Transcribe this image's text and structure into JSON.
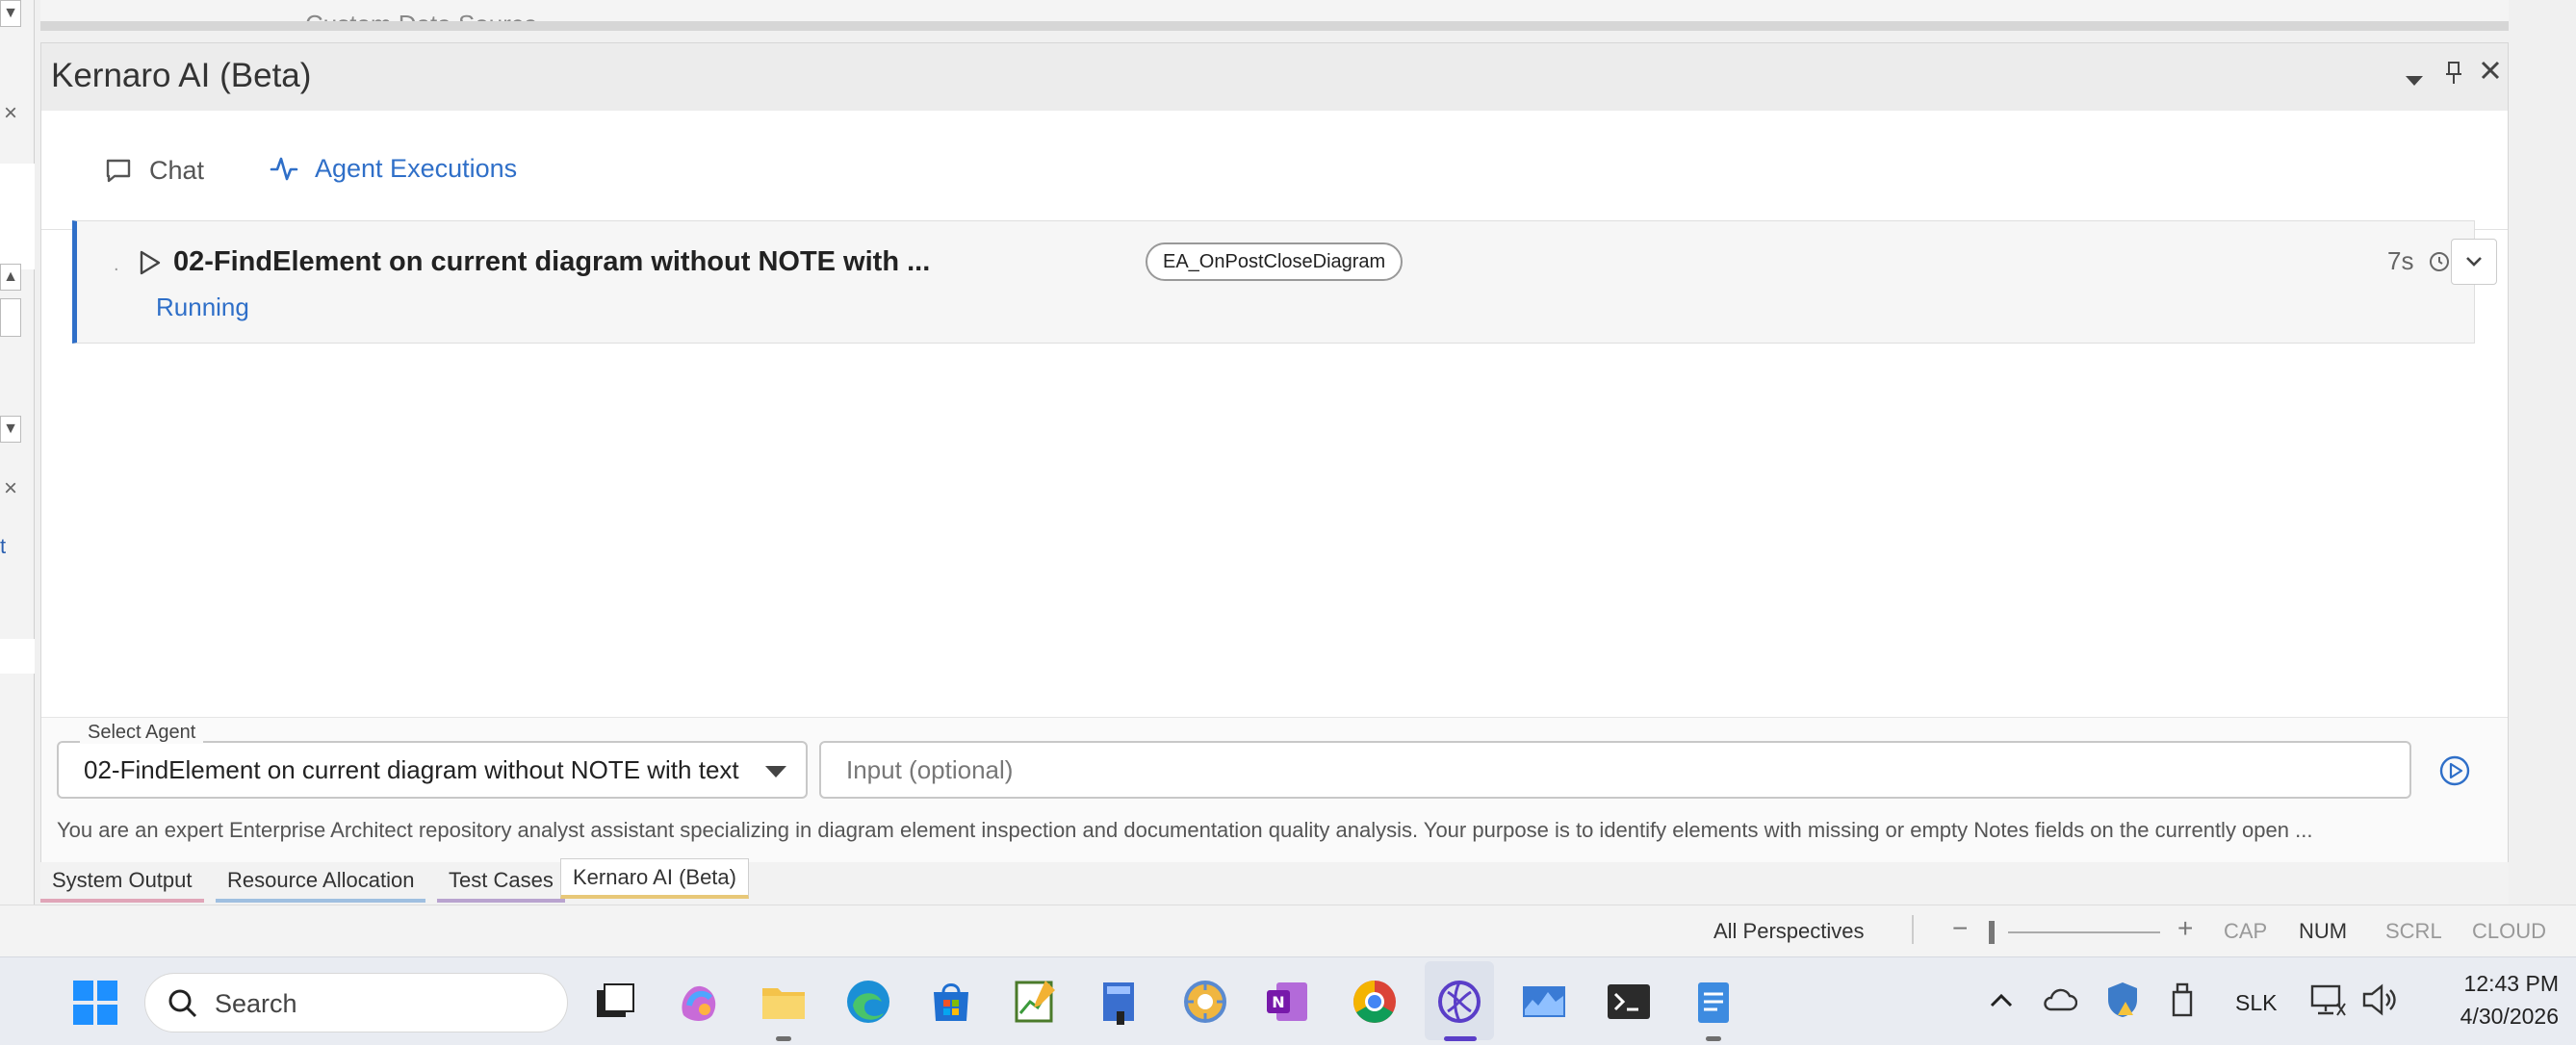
{
  "top_strip": {
    "text": "Custom Data Source"
  },
  "panel": {
    "title": "Kernaro AI (Beta)",
    "tabs": [
      {
        "label": "Chat",
        "icon": "chat-icon"
      },
      {
        "label": "Agent Executions",
        "icon": "activity-icon"
      }
    ],
    "active_tab": "Agent Executions"
  },
  "execution": {
    "prefix": ".",
    "title": "02-FindElement on current diagram without NOTE with ...",
    "status": "Running",
    "badge": "EA_OnPostCloseDiagram",
    "duration": "7s"
  },
  "agent_form": {
    "select_label": "Select Agent",
    "selected_agent": "02-FindElement on current diagram without NOTE with text",
    "input_placeholder": "Input (optional)",
    "description": "You are an expert Enterprise Architect repository analyst assistant specializing in diagram element inspection and documentation quality analysis. Your purpose is to identify elements with missing or empty Notes fields on the currently open ..."
  },
  "doc_tabs": [
    {
      "label": "System Output",
      "color": "#e0a5b8"
    },
    {
      "label": "Resource Allocation",
      "color": "#9fbfe0"
    },
    {
      "label": "Test Cases",
      "color": "#b9a3cf"
    },
    {
      "label": "Kernaro AI (Beta)",
      "color": "#e8c878",
      "active": true
    }
  ],
  "status_bar": {
    "perspective": "All Perspectives",
    "zoom_minus": "−",
    "zoom_plus": "+",
    "cap": "CAP",
    "num": "NUM",
    "scrl": "SCRL",
    "cloud": "CLOUD"
  },
  "taskbar": {
    "search_label": "Search",
    "tray_slk": "SLK",
    "time": "12:43 PM",
    "date": "4/30/2026"
  },
  "colors": {
    "accent": "#2f6fc8"
  }
}
